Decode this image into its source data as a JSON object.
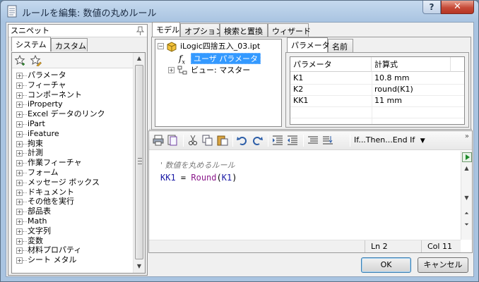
{
  "window": {
    "title": "ルールを編集: 数値の丸めルール",
    "help_label": "?",
    "close_label": "✕"
  },
  "snippets": {
    "header": "スニペット",
    "tabs": [
      "システム",
      "カスタム"
    ],
    "items": [
      "パラメータ",
      "フィーチャ",
      "コンポーネント",
      "iProperty",
      "Excel データのリンク",
      "iPart",
      "iFeature",
      "拘束",
      "計測",
      "作業フィーチャ",
      "フォーム",
      "メッセージ ボックス",
      "ドキュメント",
      "その他を実行",
      "部品表",
      "Math",
      "文字列",
      "変数",
      "材料プロパティ",
      "シート メタル"
    ]
  },
  "right_tabs": [
    "モデル",
    "オプション",
    "検索と置換",
    "ウィザード"
  ],
  "model_tree": {
    "root": "iLogic四捨五入_03.ipt",
    "user_params": "ユーザ パラメータ",
    "view": "ビュー: マスター"
  },
  "params_tabs": [
    "パラメータ",
    "名前"
  ],
  "params_table": {
    "headers": [
      "パラメータ",
      "計算式"
    ],
    "rows": [
      [
        "K1",
        "10.8 mm"
      ],
      [
        "K2",
        "round(K1)"
      ],
      [
        "KK1",
        "11 mm"
      ]
    ]
  },
  "editor": {
    "ifthen_label": "If...Then...End If",
    "dropdown_arrow": "▼",
    "overflow_chevron": "»",
    "code": {
      "comment": "' 数値を丸めるルール",
      "var": "KK1",
      "op": " = ",
      "func": "Round",
      "open": "(",
      "arg": "K1",
      "close": ")"
    },
    "status": {
      "line": "Ln 2",
      "col": "Col 11"
    }
  },
  "buttons": {
    "ok": "OK",
    "cancel": "キャンセル"
  },
  "colors": {
    "code_var": "#1a1aa6",
    "code_func": "#8b1a8b",
    "selection": "#3399ff"
  }
}
